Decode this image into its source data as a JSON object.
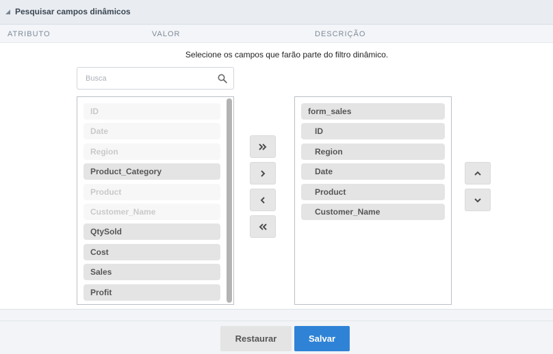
{
  "header": {
    "title": "Pesquisar campos dinâmicos"
  },
  "columns": [
    "ATRIBUTO",
    "VALOR",
    "DESCRIÇÃO"
  ],
  "instruction": "Selecione os campos que farão parte do filtro dinâmico.",
  "search": {
    "placeholder": "Busca",
    "value": ""
  },
  "available_fields": [
    {
      "label": "ID",
      "state": "disabled"
    },
    {
      "label": "Date",
      "state": "disabled"
    },
    {
      "label": "Region",
      "state": "disabled"
    },
    {
      "label": "Product_Category",
      "state": "enabled"
    },
    {
      "label": "Product",
      "state": "disabled"
    },
    {
      "label": "Customer_Name",
      "state": "disabled"
    },
    {
      "label": "QtySold",
      "state": "enabled"
    },
    {
      "label": "Cost",
      "state": "enabled"
    },
    {
      "label": "Sales",
      "state": "enabled"
    },
    {
      "label": "Profit",
      "state": "enabled"
    }
  ],
  "selected_fields": [
    {
      "label": "form_sales",
      "group": true
    },
    {
      "label": "ID",
      "group": false
    },
    {
      "label": "Region",
      "group": false
    },
    {
      "label": "Date",
      "group": false
    },
    {
      "label": "Product",
      "group": false
    },
    {
      "label": "Customer_Name",
      "group": false
    }
  ],
  "transfer_buttons": [
    {
      "name": "move-all-right-button",
      "icon": "double-chevron-right-icon"
    },
    {
      "name": "move-right-button",
      "icon": "chevron-right-icon"
    },
    {
      "name": "move-left-button",
      "icon": "chevron-left-icon"
    },
    {
      "name": "move-all-left-button",
      "icon": "double-chevron-left-icon"
    }
  ],
  "order_buttons": [
    {
      "name": "move-up-button",
      "icon": "chevron-up-icon"
    },
    {
      "name": "move-down-button",
      "icon": "chevron-down-icon"
    }
  ],
  "footer": {
    "restore_label": "Restaurar",
    "save_label": "Salvar"
  },
  "colors": {
    "header_bg": "#e9edf2",
    "primary": "#2f83d6",
    "item_enabled": "#e4e4e4",
    "item_disabled": "#f7f7f7"
  }
}
